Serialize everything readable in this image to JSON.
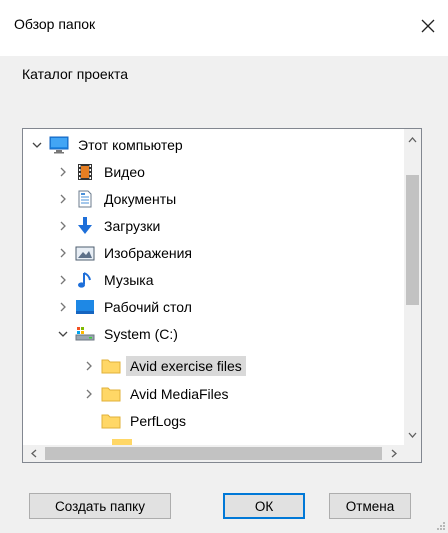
{
  "window": {
    "title": "Обзор папок",
    "description": "Каталог проекта"
  },
  "tree": {
    "items": [
      {
        "label": "Этот компьютер",
        "icon": "computer-icon",
        "expanded": true
      },
      {
        "label": "Видео",
        "icon": "video-folder-icon"
      },
      {
        "label": "Документы",
        "icon": "documents-folder-icon"
      },
      {
        "label": "Загрузки",
        "icon": "downloads-folder-icon"
      },
      {
        "label": "Изображения",
        "icon": "pictures-folder-icon"
      },
      {
        "label": "Музыка",
        "icon": "music-folder-icon"
      },
      {
        "label": "Рабочий стол",
        "icon": "desktop-folder-icon"
      },
      {
        "label": "System (C:)",
        "icon": "drive-icon",
        "expanded": true
      },
      {
        "label": "Avid exercise files",
        "icon": "folder-icon",
        "selected": true
      },
      {
        "label": "Avid MediaFiles",
        "icon": "folder-icon"
      },
      {
        "label": "PerfLogs",
        "icon": "folder-icon"
      }
    ]
  },
  "buttons": {
    "new_folder": "Создать папку",
    "ok": "ОК",
    "cancel": "Отмена"
  },
  "colors": {
    "accent": "#0078d7",
    "selection": "#d9d9d9",
    "folder": "#ffd766"
  }
}
